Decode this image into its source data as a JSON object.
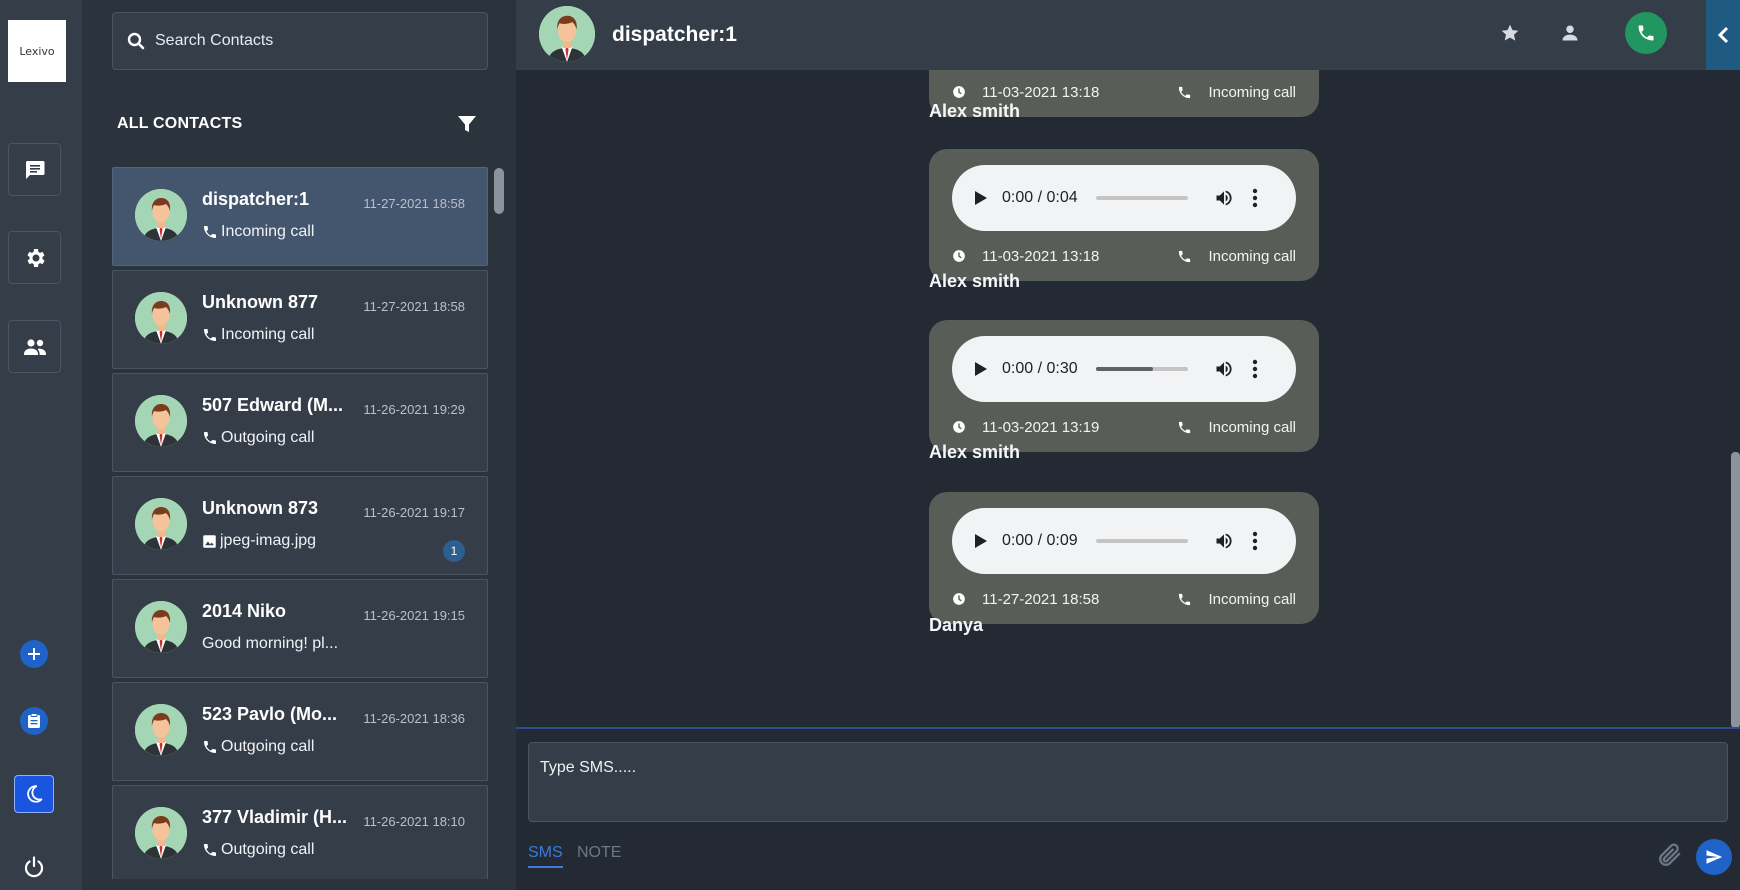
{
  "app": {
    "logo_text": "Lexivo"
  },
  "rail": {
    "items": [
      "chat-icon",
      "settings-icon",
      "contacts-icon"
    ],
    "bottom": [
      "plus-icon",
      "clipboard-icon",
      "moon-icon",
      "power-icon"
    ],
    "accent": "#1f63c9"
  },
  "search": {
    "placeholder": "Search Contacts"
  },
  "contacts_header": {
    "title": "ALL CONTACTS"
  },
  "contacts": [
    {
      "name": "dispatcher:1",
      "time": "11-27-2021 18:58",
      "sub": "Incoming call",
      "sub_icon": "phone",
      "active": true
    },
    {
      "name": "Unknown 877",
      "time": "11-27-2021 18:58",
      "sub": "Incoming call",
      "sub_icon": "phone"
    },
    {
      "name": "507 Edward (M...",
      "time": "11-26-2021 19:29",
      "sub": "Outgoing call",
      "sub_icon": "phone"
    },
    {
      "name": "Unknown 873",
      "time": "11-26-2021 19:17",
      "sub": "jpeg-imag.jpg",
      "sub_icon": "image",
      "badge": "1"
    },
    {
      "name": "2014 Niko",
      "time": "11-26-2021 19:15",
      "sub": "Good morning! pl...",
      "sub_icon": ""
    },
    {
      "name": "523 Pavlo (Mo...",
      "time": "11-26-2021 18:36",
      "sub": "Outgoing call",
      "sub_icon": "phone"
    },
    {
      "name": "377 Vladimir (H...",
      "time": "11-26-2021 18:10",
      "sub": "Outgoing call",
      "sub_icon": "phone"
    }
  ],
  "chat": {
    "title": "dispatcher:1",
    "call_color": "#229660",
    "messages": [
      {
        "date": "11-03-2021 13:18",
        "type": "Incoming call",
        "sender": "Alex smith",
        "partial": true
      },
      {
        "date": "11-03-2021 13:18",
        "type": "Incoming call",
        "sender": "Alex smith",
        "audio_time": "0:00 / 0:04",
        "progress": 0
      },
      {
        "date": "11-03-2021 13:19",
        "type": "Incoming call",
        "sender": "Alex smith",
        "audio_time": "0:00 / 0:30",
        "progress": 0.62
      },
      {
        "date": "11-27-2021 18:58",
        "type": "Incoming call",
        "sender": "Danya",
        "audio_time": "0:00 / 0:09",
        "progress": 0
      }
    ]
  },
  "composer": {
    "placeholder": "Type SMS.....",
    "tabs": [
      "SMS",
      "NOTE"
    ]
  }
}
